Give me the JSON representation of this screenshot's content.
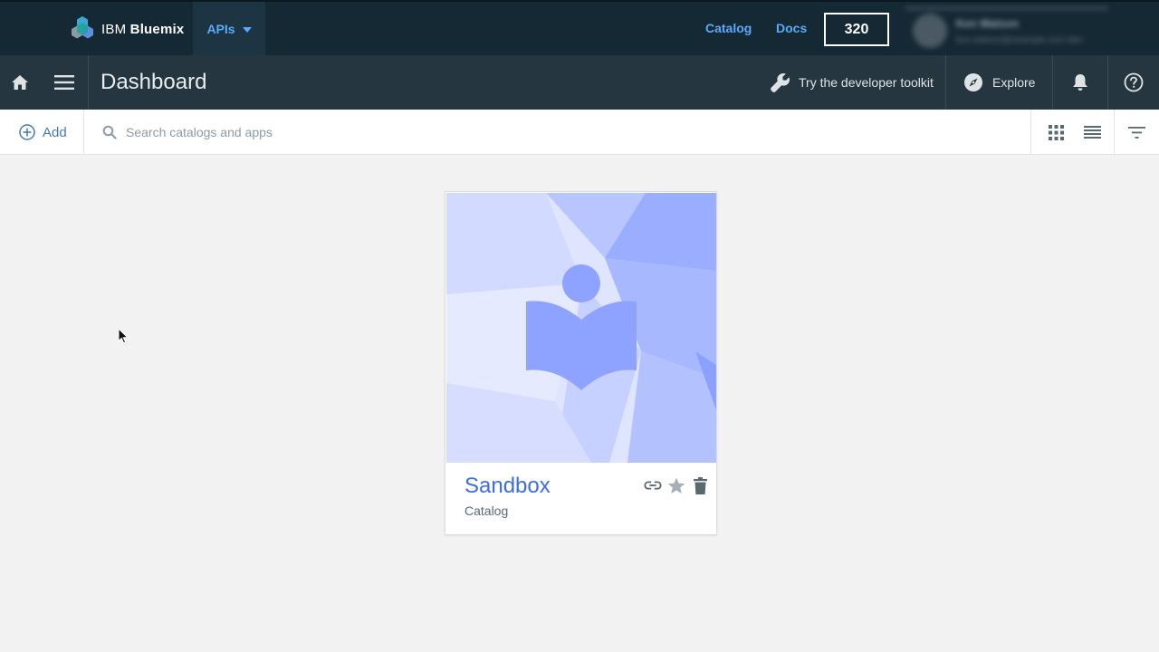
{
  "header": {
    "brand_ibm": "IBM",
    "brand_product": "Bluemix",
    "region_menu_label": "APIs",
    "catalog_link": "Catalog",
    "docs_link": "Docs",
    "counter_value": "320",
    "account_name": "Ken Watson",
    "account_sub": "ken.watson@example.com-dev"
  },
  "dashbar": {
    "title": "Dashboard",
    "toolkit_label": "Try the developer toolkit",
    "explore_label": "Explore"
  },
  "toolbar": {
    "add_label": "Add",
    "search_placeholder": "Search catalogs and apps"
  },
  "cards": [
    {
      "title": "Sandbox",
      "subtitle": "Catalog",
      "icons": [
        "link-icon",
        "star-icon",
        "trash-icon"
      ]
    }
  ],
  "colors": {
    "topbar_bg": "#152935",
    "dashbar_bg": "#263640",
    "accent_link": "#5aaafa",
    "card_title": "#3b6de4",
    "art_primary": "#8ea2ff",
    "page_bg": "#f2f2f2"
  }
}
